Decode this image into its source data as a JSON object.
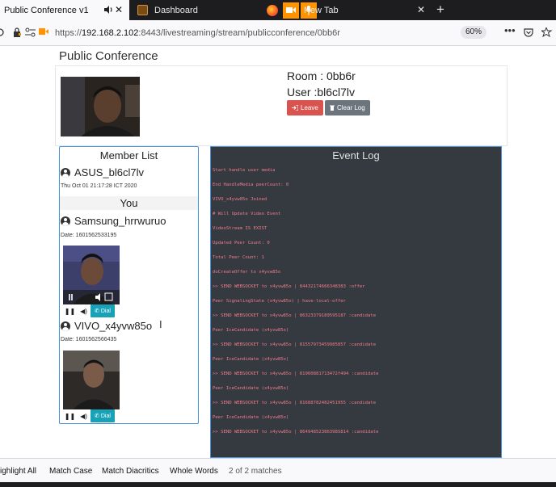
{
  "browser": {
    "tabs": [
      {
        "title": "Public Conference v1",
        "active": true
      },
      {
        "title": "Dashboard"
      },
      {
        "title": "New Tab"
      }
    ],
    "url_scheme": "https://",
    "url_host": "192.168.2.102",
    "url_rest": ":8443/livestreaming/stream/publicconference/0bb6r",
    "zoom": "60%"
  },
  "page": {
    "title": "Public Conference",
    "room_label": "Room : 0bb6r",
    "user_label": "User :bl6cl7lv",
    "leave_label": "Leave",
    "clear_log_label": "Clear Log"
  },
  "members": {
    "title": "Member List",
    "self_name": "ASUS_bl6cl7lv",
    "self_joined": "Thu Oct 01 21:17:28 ICT 2020",
    "you_label": "You",
    "peers": [
      {
        "name": "Samsung_hrrwuruo",
        "date": "Date: 1601562533195",
        "dial": "Dial"
      },
      {
        "name": "VIVO_x4yvw85o",
        "date": "Date: 1601562566435",
        "dial": "Dial"
      }
    ]
  },
  "event_log": {
    "title": "Event Log",
    "entries": [
      "Start handle user media",
      "End HandleMedia peerCount: 0",
      "VIVO_x4yvw85o Joined",
      "# Will Update Video Event",
      "VideoStream IS EXIST",
      "Updated Peer Count: 0",
      "Total Peer Count: 1",
      "doCreateOffer to x4yvw85o",
      ">> SEND WEBSOCKET to x4yvw85o | 84432174666348383 :offer",
      "Peer SignalingState (x4yvw85o) | have-local-offer",
      ">> SEND WEBSOCKET to x4yvw85o | 86323379189595187 :candidate",
      "Peer IceCandidate (x4yvw85o)",
      ">> SEND WEBSOCKET to x4yvw85o | 81557973459985857 :candidate",
      "Peer IceCandidate (x4yvw85o)",
      ">> SEND WEBSOCKET to x4yvw85o | 81960881713472f494 :candidate",
      "Peer IceCandidate (x4yvw85o)",
      ">> SEND WEBSOCKET to x4yvw85o | 81688782482451955 :candidate",
      "Peer IceCandidate (x4yvw85o)",
      ">> SEND WEBSOCKET to x4yvw85o | 86494852386398S814 :candidate"
    ]
  },
  "findbar": {
    "highlight_all": "ighlight All",
    "match_case": "Match Case",
    "match_diacritics": "Match Diacritics",
    "whole_words": "Whole Words",
    "status": "2 of 2 matches"
  },
  "colors": {
    "leave": "#d9534f",
    "clear": "#6c757d",
    "dial": "#17a2b8",
    "log_bg": "#343a40",
    "log_text": "#f07b8a",
    "panel_border": "#4a90d9"
  }
}
